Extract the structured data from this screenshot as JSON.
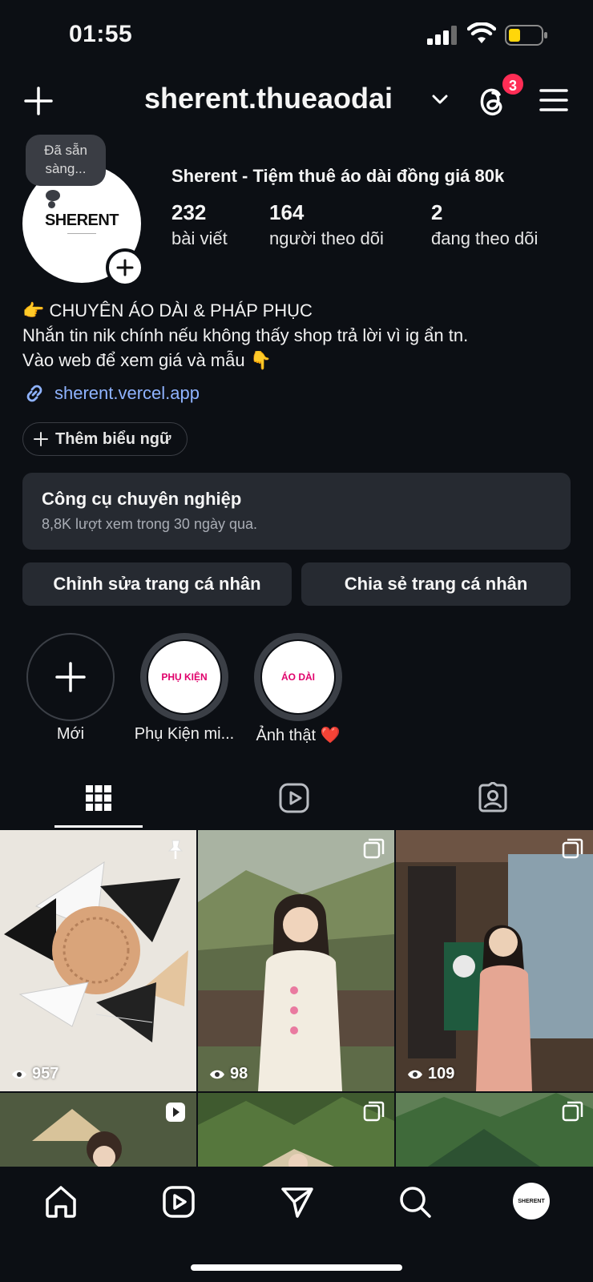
{
  "status_bar": {
    "time": "01:55"
  },
  "header": {
    "username": "sherent.thueaodai",
    "notification_count": "3"
  },
  "profile": {
    "note": "Đã sẵn sàng...",
    "avatar_text": "SHERENT",
    "display_name": "Sherent - Tiệm thuê áo dài đồng giá 80k",
    "stats": [
      {
        "value": "232",
        "label": "bài viết"
      },
      {
        "value": "164",
        "label": "người theo dõi"
      },
      {
        "value": "2",
        "label": "đang theo dõi"
      }
    ],
    "bio": [
      "👉 CHUYÊN ÁO DÀI & PHÁP PHỤC",
      "Nhắn tin nik chính nếu không thấy shop trả lời vì ig ẩn tn.",
      "Vào web để xem giá và mẫu 👇"
    ],
    "link": "sherent.vercel.app",
    "add_banner": "Thêm biểu ngữ"
  },
  "pro_tools": {
    "title": "Công cụ chuyên nghiệp",
    "subtitle": "8,8K lượt xem trong 30 ngày qua."
  },
  "actions": {
    "edit": "Chỉnh sửa trang cá nhân",
    "share": "Chia sẻ trang cá nhân"
  },
  "highlights": [
    {
      "label": "Mới",
      "cover": ""
    },
    {
      "label": "Phụ Kiện mi...",
      "cover": "PHỤ KIỆN"
    },
    {
      "label": "Ảnh thật ❤️",
      "cover": "ÁO DÀI"
    }
  ],
  "posts": [
    {
      "views": "957",
      "icon": "pin-icon"
    },
    {
      "views": "98",
      "icon": "carousel-icon"
    },
    {
      "views": "109",
      "icon": "carousel-icon"
    },
    {
      "views": "",
      "icon": "reel-icon"
    },
    {
      "views": "",
      "icon": "carousel-icon"
    },
    {
      "views": "",
      "icon": "carousel-icon"
    }
  ],
  "nav": {
    "avatar_text": "SHERENT"
  },
  "colors": {
    "background": "#0c0f14",
    "card": "#262a31",
    "link": "#8fb3ff",
    "badge": "#ff2d55",
    "battery": "#ffd60a"
  }
}
